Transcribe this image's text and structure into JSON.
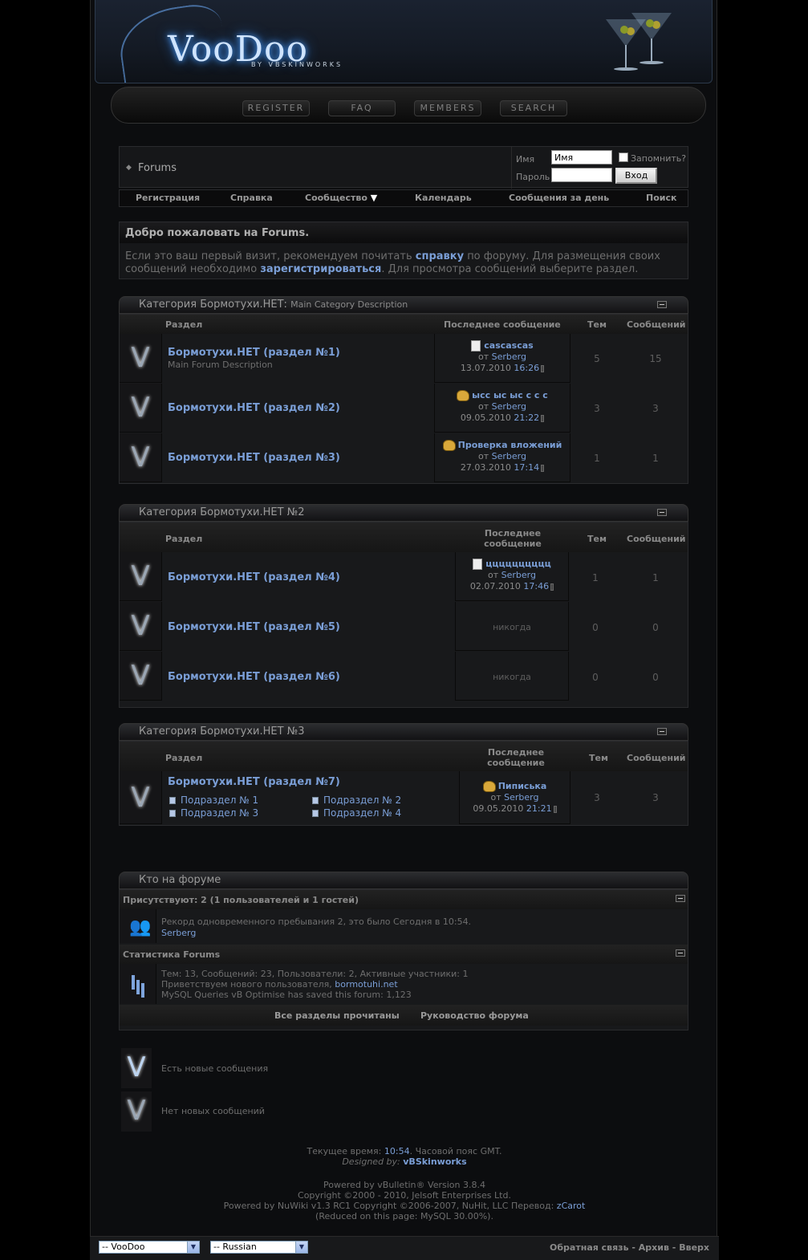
{
  "logo": {
    "text": "VooDoo",
    "subtitle": "BY VBSKINWORKS"
  },
  "top_nav": [
    "REGISTER",
    "FAQ",
    "MEMBERS",
    "SEARCH"
  ],
  "breadcrumb": "Forums",
  "login": {
    "user_label": "Имя",
    "user_value": "Имя",
    "remember_label": "Запомнить?",
    "pass_label": "Пароль",
    "submit": "Вход"
  },
  "nav": [
    "Регистрация",
    "Справка",
    "Сообщество",
    "Календарь",
    "Сообщения за день",
    "Поиск"
  ],
  "welcome": {
    "title": "Добро пожаловать на Forums.",
    "text1": "Если это ваш первый визит, рекомендуем почитать",
    "link1": "справку",
    "text2": "по форуму. Для размещения своих",
    "text3": "сообщений необходимо",
    "link2": "зарегистрироваться",
    "text4": ". Для просмотра сообщений выберите раздел."
  },
  "columns": {
    "forum": "Раздел",
    "last_post": "Последнее сообщение",
    "last_post_l1": "Последнее",
    "last_post_l2": "сообщение",
    "threads": "Тем",
    "posts": "Сообщений"
  },
  "categories": [
    {
      "title": "Категория Бормотухи.НЕТ:",
      "desc": "Main Category Description",
      "forums": [
        {
          "title": "Бормотухи.НЕТ (раздел №1)",
          "desc": "Main Forum Description",
          "lp_title": "cascascas",
          "lp_by": "от",
          "lp_user": "Serberg",
          "lp_date": "13.07.2010",
          "lp_time": "16:26",
          "threads": "5",
          "posts": "15"
        },
        {
          "title": "Бормотухи.НЕТ (раздел №2)",
          "lp_title": "ысс ыс ыс с с с",
          "lp_by": "от",
          "lp_user": "Serberg",
          "lp_date": "09.05.2010",
          "lp_time": "21:22",
          "threads": "3",
          "posts": "3"
        },
        {
          "title": "Бормотухи.НЕТ (раздел №3)",
          "lp_title": "Проверка вложений",
          "lp_by": "от",
          "lp_user": "Serberg",
          "lp_date": "27.03.2010",
          "lp_time": "17:14",
          "threads": "1",
          "posts": "1"
        }
      ]
    },
    {
      "title": "Категория Бормотухи.НЕТ №2",
      "forums": [
        {
          "title": "Бормотухи.НЕТ (раздел №4)",
          "lp_title": "цццццццццц",
          "lp_by": "от",
          "lp_user": "Serberg",
          "lp_date": "02.07.2010",
          "lp_time": "17:46",
          "threads": "1",
          "posts": "1"
        },
        {
          "title": "Бормотухи.НЕТ (раздел №5)",
          "lp_never": "никогда",
          "threads": "0",
          "posts": "0"
        },
        {
          "title": "Бормотухи.НЕТ (раздел №6)",
          "lp_never": "никогда",
          "threads": "0",
          "posts": "0"
        }
      ]
    },
    {
      "title": "Категория Бормотухи.НЕТ №3",
      "forums": [
        {
          "title": "Бормотухи.НЕТ (раздел №7)",
          "subforums": [
            "Подраздел № 1",
            "Подраздел № 2",
            "Подраздел № 3",
            "Подраздел № 4"
          ],
          "lp_title": "Пиписька",
          "lp_by": "от",
          "lp_user": "Serberg",
          "lp_date": "09.05.2010",
          "lp_time": "21:21",
          "threads": "3",
          "posts": "3"
        }
      ]
    }
  ],
  "whos_online": {
    "title": "Кто на форуме",
    "present": "Присутствуют: 2 (1 пользователей и 1 гостей)",
    "record": "Рекорд одновременного пребывания 2, это было Сегодня в 10:54.",
    "user": "Serberg",
    "stats_title": "Статистика Forums",
    "stats": "Тем: 13, Сообщений: 23, Пользователи: 2, Активные участники: 1",
    "newest_prefix": "Приветствуем нового пользователя,",
    "newest": "bormotuhi.net",
    "mysql": "MySQL Queries vB Optimise has saved this forum: 1,123",
    "mark_read": "Все разделы прочитаны",
    "guidelines": "Руководство форума"
  },
  "legend": {
    "new": "Есть новые сообщения",
    "old": "Нет новых сообщений"
  },
  "footer": {
    "time_prefix": "Текущее время:",
    "time": "10:54",
    "time_suffix": ". Часовой пояс GMT.",
    "designed_by": "Designed by:",
    "designer": "vBSkinworks",
    "powered": "Powered by vBulletin® Version 3.8.4",
    "copyright": "Copyright ©2000 - 2010, Jelsoft Enterprises Ltd.",
    "nuwiki": "Powered by NuWiki v1.3 RC1 Copyright ©2006-2007, NuHit, LLC Перевод:",
    "translator": "zCarot",
    "reduced": "(Reduced on this page: MySQL 30.00%)."
  },
  "bottom": {
    "style": "-- VooDoo",
    "language": "-- Russian",
    "contact": "Обратная связь",
    "archive": "Архив",
    "top": "Вверх",
    "sep": "-"
  }
}
